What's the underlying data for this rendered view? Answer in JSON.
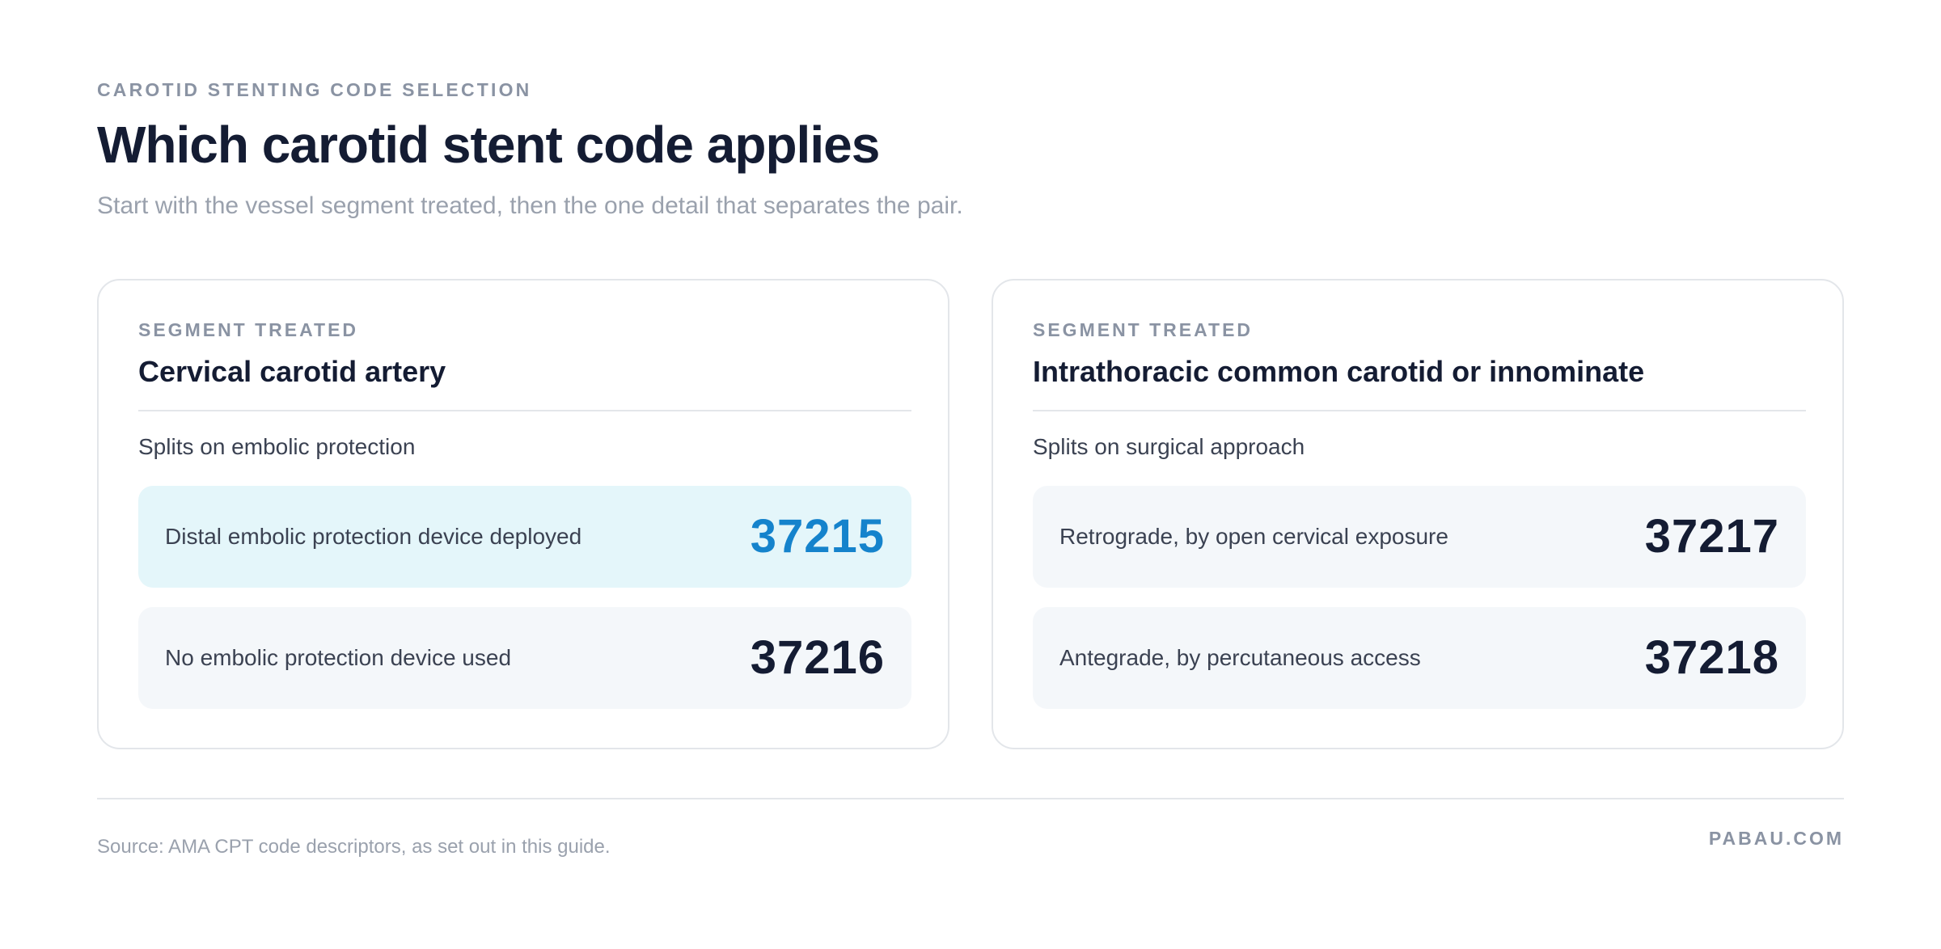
{
  "header": {
    "eyebrow": "CAROTID STENTING CODE SELECTION",
    "title": "Which carotid stent code applies",
    "subtitle": "Start with the vessel segment treated, then the one detail that separates the pair."
  },
  "cards": [
    {
      "label": "SEGMENT TREATED",
      "title": "Cervical carotid artery",
      "split_note": "Splits on embolic protection",
      "options": [
        {
          "text": "Distal embolic protection device deployed",
          "code": "37215",
          "highlighted": true
        },
        {
          "text": "No embolic protection device used",
          "code": "37216",
          "highlighted": false
        }
      ]
    },
    {
      "label": "SEGMENT TREATED",
      "title": "Intrathoracic common carotid or innominate",
      "split_note": "Splits on surgical approach",
      "options": [
        {
          "text": "Retrograde, by open cervical exposure",
          "code": "37217",
          "highlighted": false
        },
        {
          "text": "Antegrade, by percutaneous access",
          "code": "37218",
          "highlighted": false
        }
      ]
    }
  ],
  "footer": {
    "source": "Source: AMA CPT code descriptors, as set out in this guide.",
    "brand": "PABAU.COM"
  },
  "colors": {
    "accent": "#1583cc",
    "highlight_bg": "#e4f6fa",
    "option_bg": "#f4f7fa",
    "text_dark": "#141c33",
    "text_muted": "#8a93a3"
  }
}
